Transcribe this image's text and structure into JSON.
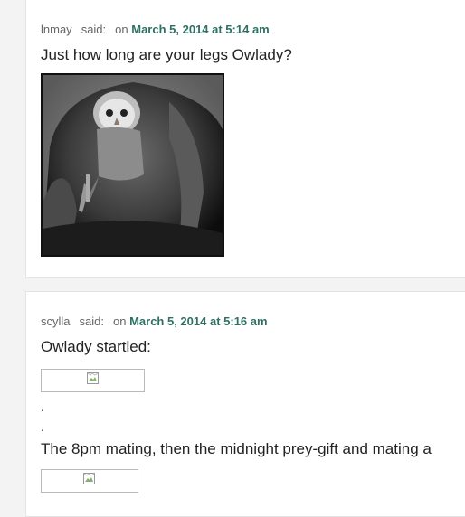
{
  "comments": [
    {
      "author": "lnmay",
      "said": "said:",
      "on": "on",
      "date": "March 5, 2014 at 5:14 am",
      "text": "Just how long are your legs Owlady?"
    },
    {
      "author": "scylla",
      "said": "said:",
      "on": "on",
      "date": "March 5, 2014 at 5:16 am",
      "text1": "Owlady startled:",
      "dot1": ".",
      "dot2": ".",
      "text2": "The 8pm mating, then the midnight prey-gift and mating a"
    }
  ],
  "icons": {
    "image": "broken-image-icon"
  }
}
